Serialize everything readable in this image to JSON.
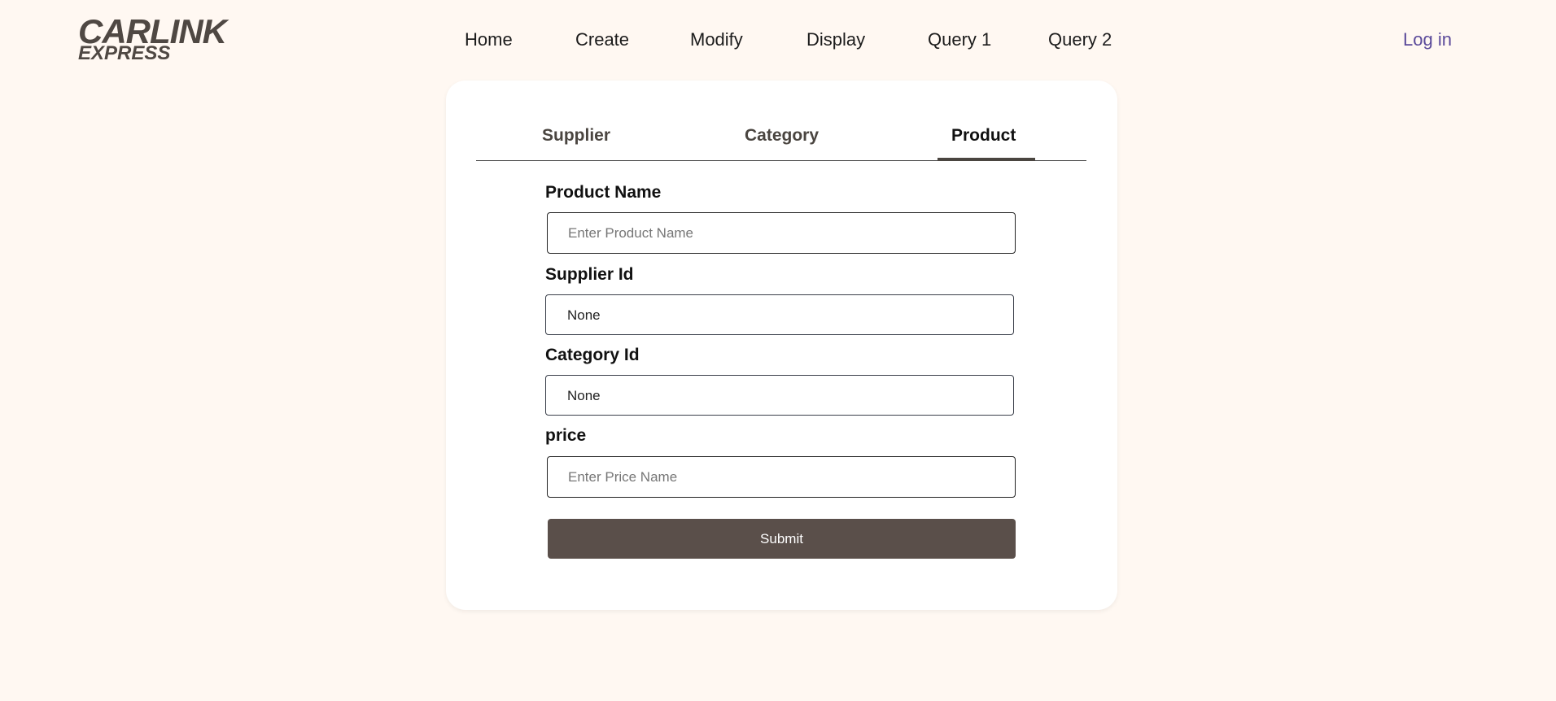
{
  "header": {
    "logo_line1": "CARLINK",
    "logo_line2": "EXPRESS",
    "nav": {
      "home": "Home",
      "create": "Create",
      "modify": "Modify",
      "display": "Display",
      "query1": "Query 1",
      "query2": "Query 2"
    },
    "login": "Log in"
  },
  "tabs": {
    "supplier": "Supplier",
    "category": "Category",
    "product": "Product",
    "active": "Product"
  },
  "form": {
    "product_name": {
      "label": "Product Name",
      "placeholder": "Enter Product Name",
      "value": ""
    },
    "supplier_id": {
      "label": "Supplier Id",
      "value": "None"
    },
    "category_id": {
      "label": "Category Id",
      "value": "None"
    },
    "price": {
      "label": "price",
      "placeholder": "Enter Price Name",
      "value": ""
    },
    "submit_label": "Submit"
  },
  "colors": {
    "background": "#fff8f2",
    "card": "#ffffff",
    "accent": "#5a4f4a",
    "login_link": "#5b4a9a"
  }
}
